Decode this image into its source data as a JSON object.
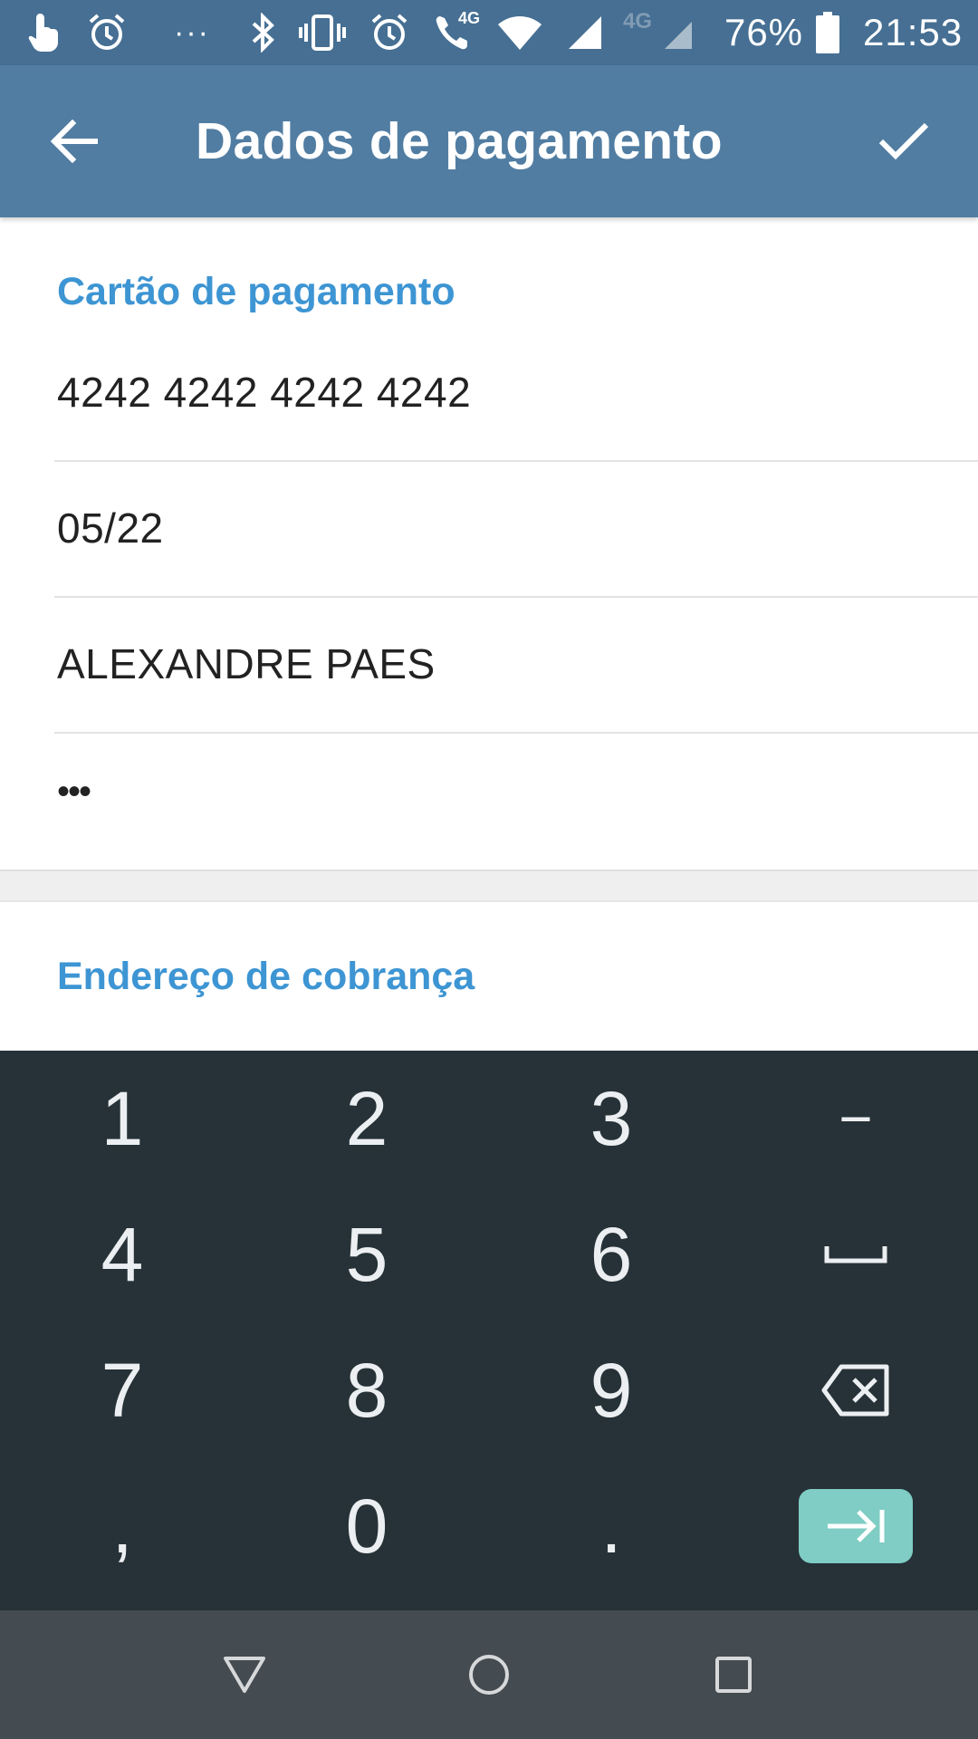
{
  "status_bar": {
    "dots": "···",
    "network_4g": "4G",
    "network_4g_2": "4G",
    "battery_percent": "76%",
    "time": "21:53",
    "icons": [
      "touch-gesture-icon",
      "alarm-icon",
      "bluetooth-icon",
      "vibrate-icon",
      "alarm-icon",
      "wifi-call-icon",
      "wifi-icon",
      "signal-icon",
      "signal-weak-icon",
      "battery-icon"
    ]
  },
  "app_bar": {
    "title": "Dados de pagamento",
    "back_icon": "arrow-back-icon",
    "done_icon": "checkmark-icon"
  },
  "form": {
    "card_section_title": "Cartão de pagamento",
    "card_number": "4242 4242 4242 4242",
    "expiry": "05/22",
    "cardholder": "ALEXANDRE PAES",
    "cvc_masked": "•••",
    "billing_section_title": "Endereço de cobrança"
  },
  "keyboard": {
    "rows": [
      [
        "1",
        "2",
        "3",
        "−"
      ],
      [
        "4",
        "5",
        "6",
        "space"
      ],
      [
        "7",
        "8",
        "9",
        "backspace"
      ],
      [
        ",",
        "0",
        ".",
        "next"
      ]
    ],
    "accent_color": "#7fcdc4"
  },
  "nav_bar": {
    "icons": [
      "back-triangle-icon",
      "home-circle-icon",
      "recents-square-icon"
    ]
  },
  "colors": {
    "status_bar": "#466f93",
    "app_bar": "#517da2",
    "section_header": "#3d95d3",
    "keyboard_bg": "#263238",
    "nav_bar": "#444b51"
  }
}
